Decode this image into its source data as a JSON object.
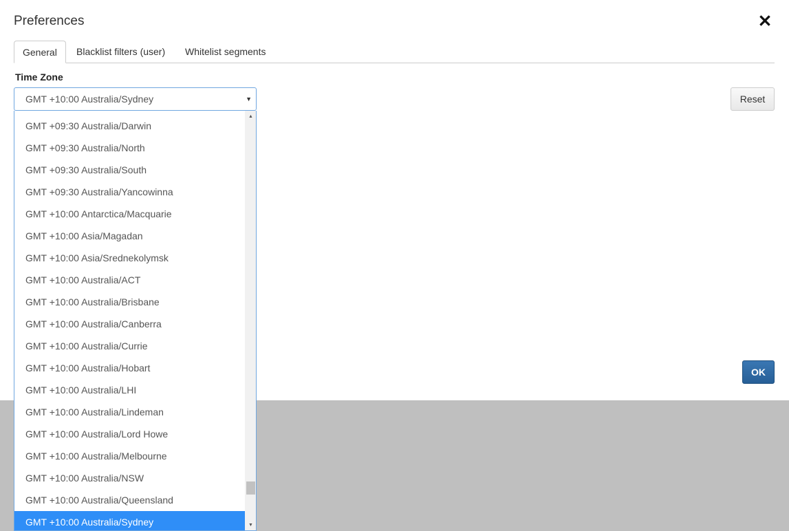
{
  "dialog": {
    "title": "Preferences",
    "close_icon": "close-x-icon"
  },
  "tabs": [
    {
      "label": "General",
      "active": true
    },
    {
      "label": "Blacklist filters (user)",
      "active": false
    },
    {
      "label": "Whitelist segments",
      "active": false
    }
  ],
  "time_zone": {
    "label": "Time Zone",
    "selected": "GMT +10:00 Australia/Sydney",
    "options": [
      "GMT +09:30 Australia/Darwin",
      "GMT +09:30 Australia/North",
      "GMT +09:30 Australia/South",
      "GMT +09:30 Australia/Yancowinna",
      "GMT +10:00 Antarctica/Macquarie",
      "GMT +10:00 Asia/Magadan",
      "GMT +10:00 Asia/Srednekolymsk",
      "GMT +10:00 Australia/ACT",
      "GMT +10:00 Australia/Brisbane",
      "GMT +10:00 Australia/Canberra",
      "GMT +10:00 Australia/Currie",
      "GMT +10:00 Australia/Hobart",
      "GMT +10:00 Australia/LHI",
      "GMT +10:00 Australia/Lindeman",
      "GMT +10:00 Australia/Lord Howe",
      "GMT +10:00 Australia/Melbourne",
      "GMT +10:00 Australia/NSW",
      "GMT +10:00 Australia/Queensland",
      "GMT +10:00 Australia/Sydney"
    ],
    "selected_index": 18
  },
  "buttons": {
    "reset_label": "Reset",
    "ok_label": "OK"
  },
  "colors": {
    "accent": "#2f8ef7",
    "ok_button": "#2f6aa4",
    "overlay": "#bfbfbf"
  }
}
